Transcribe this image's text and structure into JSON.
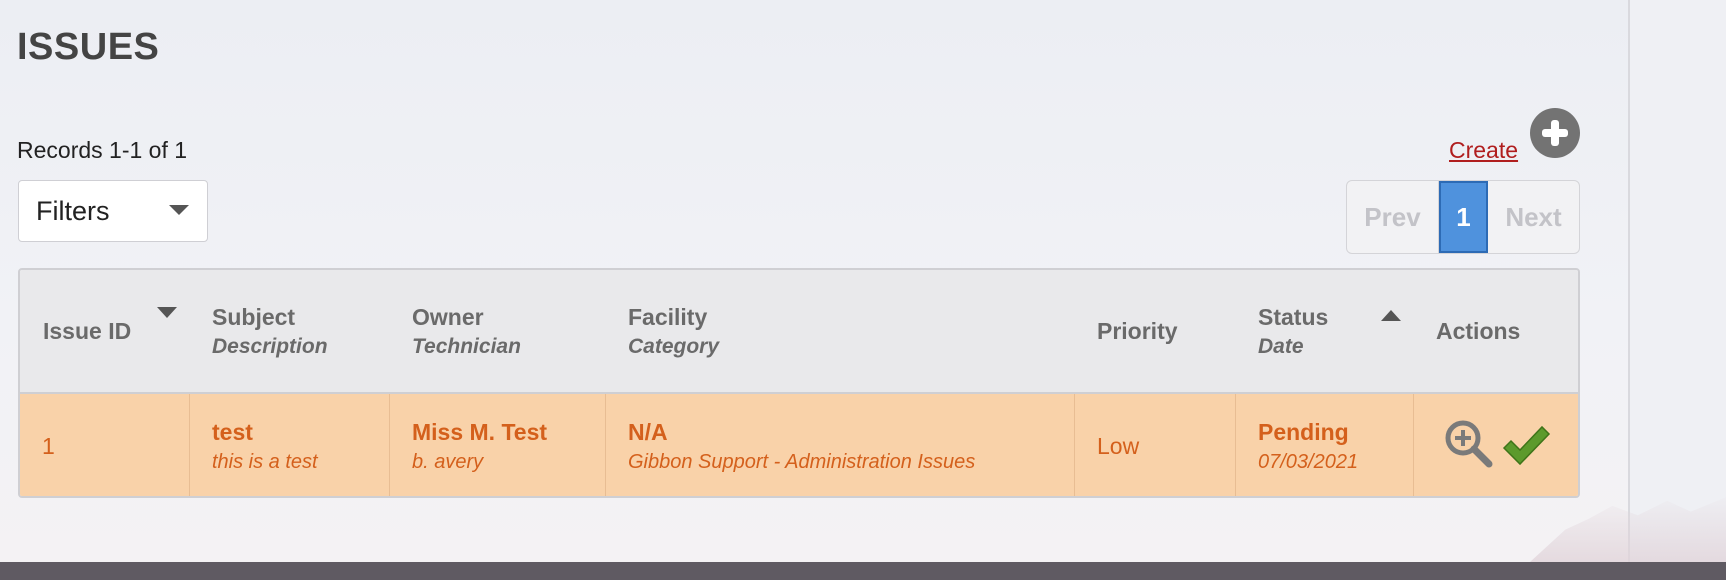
{
  "page": {
    "title": "ISSUES"
  },
  "toolbar": {
    "records_text": "Records 1-1 of 1",
    "filters_label": "Filters",
    "create_label": "Create",
    "add_icon": "plus-circle-icon"
  },
  "pagination": {
    "prev_label": "Prev",
    "current_page": "1",
    "next_label": "Next"
  },
  "table": {
    "headers": {
      "issue_id": "Issue ID",
      "subject": "Subject",
      "description": "Description",
      "owner": "Owner",
      "technician": "Technician",
      "facility": "Facility",
      "category": "Category",
      "priority": "Priority",
      "status": "Status",
      "date": "Date",
      "actions": "Actions"
    },
    "rows": [
      {
        "issue_id": "1",
        "subject": "test",
        "description": "this is a test",
        "owner": "Miss M. Test",
        "technician": "b. avery",
        "facility": "N/A",
        "category": "Gibbon Support - Administration Issues",
        "priority": "Low",
        "status": "Pending",
        "date": "07/03/2021",
        "actions": [
          "magnify-plus-icon",
          "checkmark-icon"
        ]
      }
    ]
  },
  "colors": {
    "title": "#444444",
    "link": "#b01e1e",
    "row_highlight": "#f9d2a9",
    "row_text": "#d4601c",
    "pager_active": "#4f92dd",
    "header_bg": "#e9e9eb"
  }
}
